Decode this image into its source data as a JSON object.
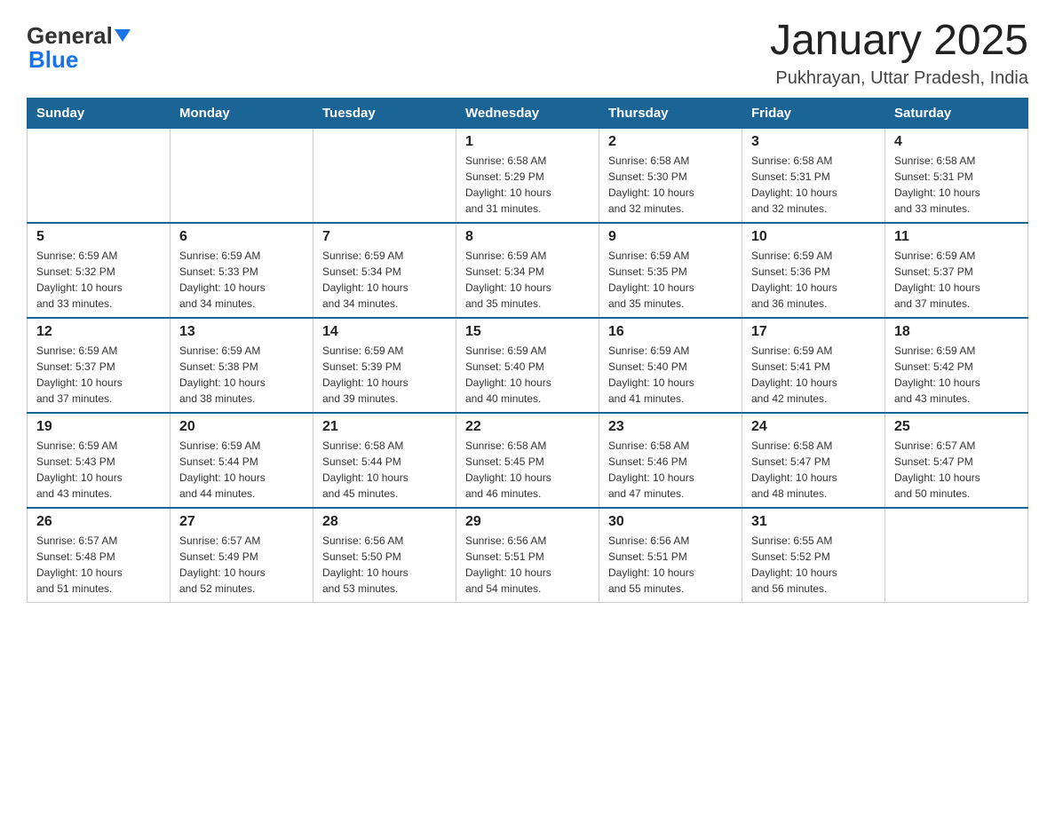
{
  "header": {
    "logo": {
      "general": "General",
      "blue": "Blue"
    },
    "title": "January 2025",
    "location": "Pukhrayan, Uttar Pradesh, India"
  },
  "calendar": {
    "days_of_week": [
      "Sunday",
      "Monday",
      "Tuesday",
      "Wednesday",
      "Thursday",
      "Friday",
      "Saturday"
    ],
    "weeks": [
      {
        "days": [
          {
            "number": "",
            "info": ""
          },
          {
            "number": "",
            "info": ""
          },
          {
            "number": "",
            "info": ""
          },
          {
            "number": "1",
            "info": "Sunrise: 6:58 AM\nSunset: 5:29 PM\nDaylight: 10 hours\nand 31 minutes."
          },
          {
            "number": "2",
            "info": "Sunrise: 6:58 AM\nSunset: 5:30 PM\nDaylight: 10 hours\nand 32 minutes."
          },
          {
            "number": "3",
            "info": "Sunrise: 6:58 AM\nSunset: 5:31 PM\nDaylight: 10 hours\nand 32 minutes."
          },
          {
            "number": "4",
            "info": "Sunrise: 6:58 AM\nSunset: 5:31 PM\nDaylight: 10 hours\nand 33 minutes."
          }
        ]
      },
      {
        "days": [
          {
            "number": "5",
            "info": "Sunrise: 6:59 AM\nSunset: 5:32 PM\nDaylight: 10 hours\nand 33 minutes."
          },
          {
            "number": "6",
            "info": "Sunrise: 6:59 AM\nSunset: 5:33 PM\nDaylight: 10 hours\nand 34 minutes."
          },
          {
            "number": "7",
            "info": "Sunrise: 6:59 AM\nSunset: 5:34 PM\nDaylight: 10 hours\nand 34 minutes."
          },
          {
            "number": "8",
            "info": "Sunrise: 6:59 AM\nSunset: 5:34 PM\nDaylight: 10 hours\nand 35 minutes."
          },
          {
            "number": "9",
            "info": "Sunrise: 6:59 AM\nSunset: 5:35 PM\nDaylight: 10 hours\nand 35 minutes."
          },
          {
            "number": "10",
            "info": "Sunrise: 6:59 AM\nSunset: 5:36 PM\nDaylight: 10 hours\nand 36 minutes."
          },
          {
            "number": "11",
            "info": "Sunrise: 6:59 AM\nSunset: 5:37 PM\nDaylight: 10 hours\nand 37 minutes."
          }
        ]
      },
      {
        "days": [
          {
            "number": "12",
            "info": "Sunrise: 6:59 AM\nSunset: 5:37 PM\nDaylight: 10 hours\nand 37 minutes."
          },
          {
            "number": "13",
            "info": "Sunrise: 6:59 AM\nSunset: 5:38 PM\nDaylight: 10 hours\nand 38 minutes."
          },
          {
            "number": "14",
            "info": "Sunrise: 6:59 AM\nSunset: 5:39 PM\nDaylight: 10 hours\nand 39 minutes."
          },
          {
            "number": "15",
            "info": "Sunrise: 6:59 AM\nSunset: 5:40 PM\nDaylight: 10 hours\nand 40 minutes."
          },
          {
            "number": "16",
            "info": "Sunrise: 6:59 AM\nSunset: 5:40 PM\nDaylight: 10 hours\nand 41 minutes."
          },
          {
            "number": "17",
            "info": "Sunrise: 6:59 AM\nSunset: 5:41 PM\nDaylight: 10 hours\nand 42 minutes."
          },
          {
            "number": "18",
            "info": "Sunrise: 6:59 AM\nSunset: 5:42 PM\nDaylight: 10 hours\nand 43 minutes."
          }
        ]
      },
      {
        "days": [
          {
            "number": "19",
            "info": "Sunrise: 6:59 AM\nSunset: 5:43 PM\nDaylight: 10 hours\nand 43 minutes."
          },
          {
            "number": "20",
            "info": "Sunrise: 6:59 AM\nSunset: 5:44 PM\nDaylight: 10 hours\nand 44 minutes."
          },
          {
            "number": "21",
            "info": "Sunrise: 6:58 AM\nSunset: 5:44 PM\nDaylight: 10 hours\nand 45 minutes."
          },
          {
            "number": "22",
            "info": "Sunrise: 6:58 AM\nSunset: 5:45 PM\nDaylight: 10 hours\nand 46 minutes."
          },
          {
            "number": "23",
            "info": "Sunrise: 6:58 AM\nSunset: 5:46 PM\nDaylight: 10 hours\nand 47 minutes."
          },
          {
            "number": "24",
            "info": "Sunrise: 6:58 AM\nSunset: 5:47 PM\nDaylight: 10 hours\nand 48 minutes."
          },
          {
            "number": "25",
            "info": "Sunrise: 6:57 AM\nSunset: 5:47 PM\nDaylight: 10 hours\nand 50 minutes."
          }
        ]
      },
      {
        "days": [
          {
            "number": "26",
            "info": "Sunrise: 6:57 AM\nSunset: 5:48 PM\nDaylight: 10 hours\nand 51 minutes."
          },
          {
            "number": "27",
            "info": "Sunrise: 6:57 AM\nSunset: 5:49 PM\nDaylight: 10 hours\nand 52 minutes."
          },
          {
            "number": "28",
            "info": "Sunrise: 6:56 AM\nSunset: 5:50 PM\nDaylight: 10 hours\nand 53 minutes."
          },
          {
            "number": "29",
            "info": "Sunrise: 6:56 AM\nSunset: 5:51 PM\nDaylight: 10 hours\nand 54 minutes."
          },
          {
            "number": "30",
            "info": "Sunrise: 6:56 AM\nSunset: 5:51 PM\nDaylight: 10 hours\nand 55 minutes."
          },
          {
            "number": "31",
            "info": "Sunrise: 6:55 AM\nSunset: 5:52 PM\nDaylight: 10 hours\nand 56 minutes."
          },
          {
            "number": "",
            "info": ""
          }
        ]
      }
    ]
  }
}
